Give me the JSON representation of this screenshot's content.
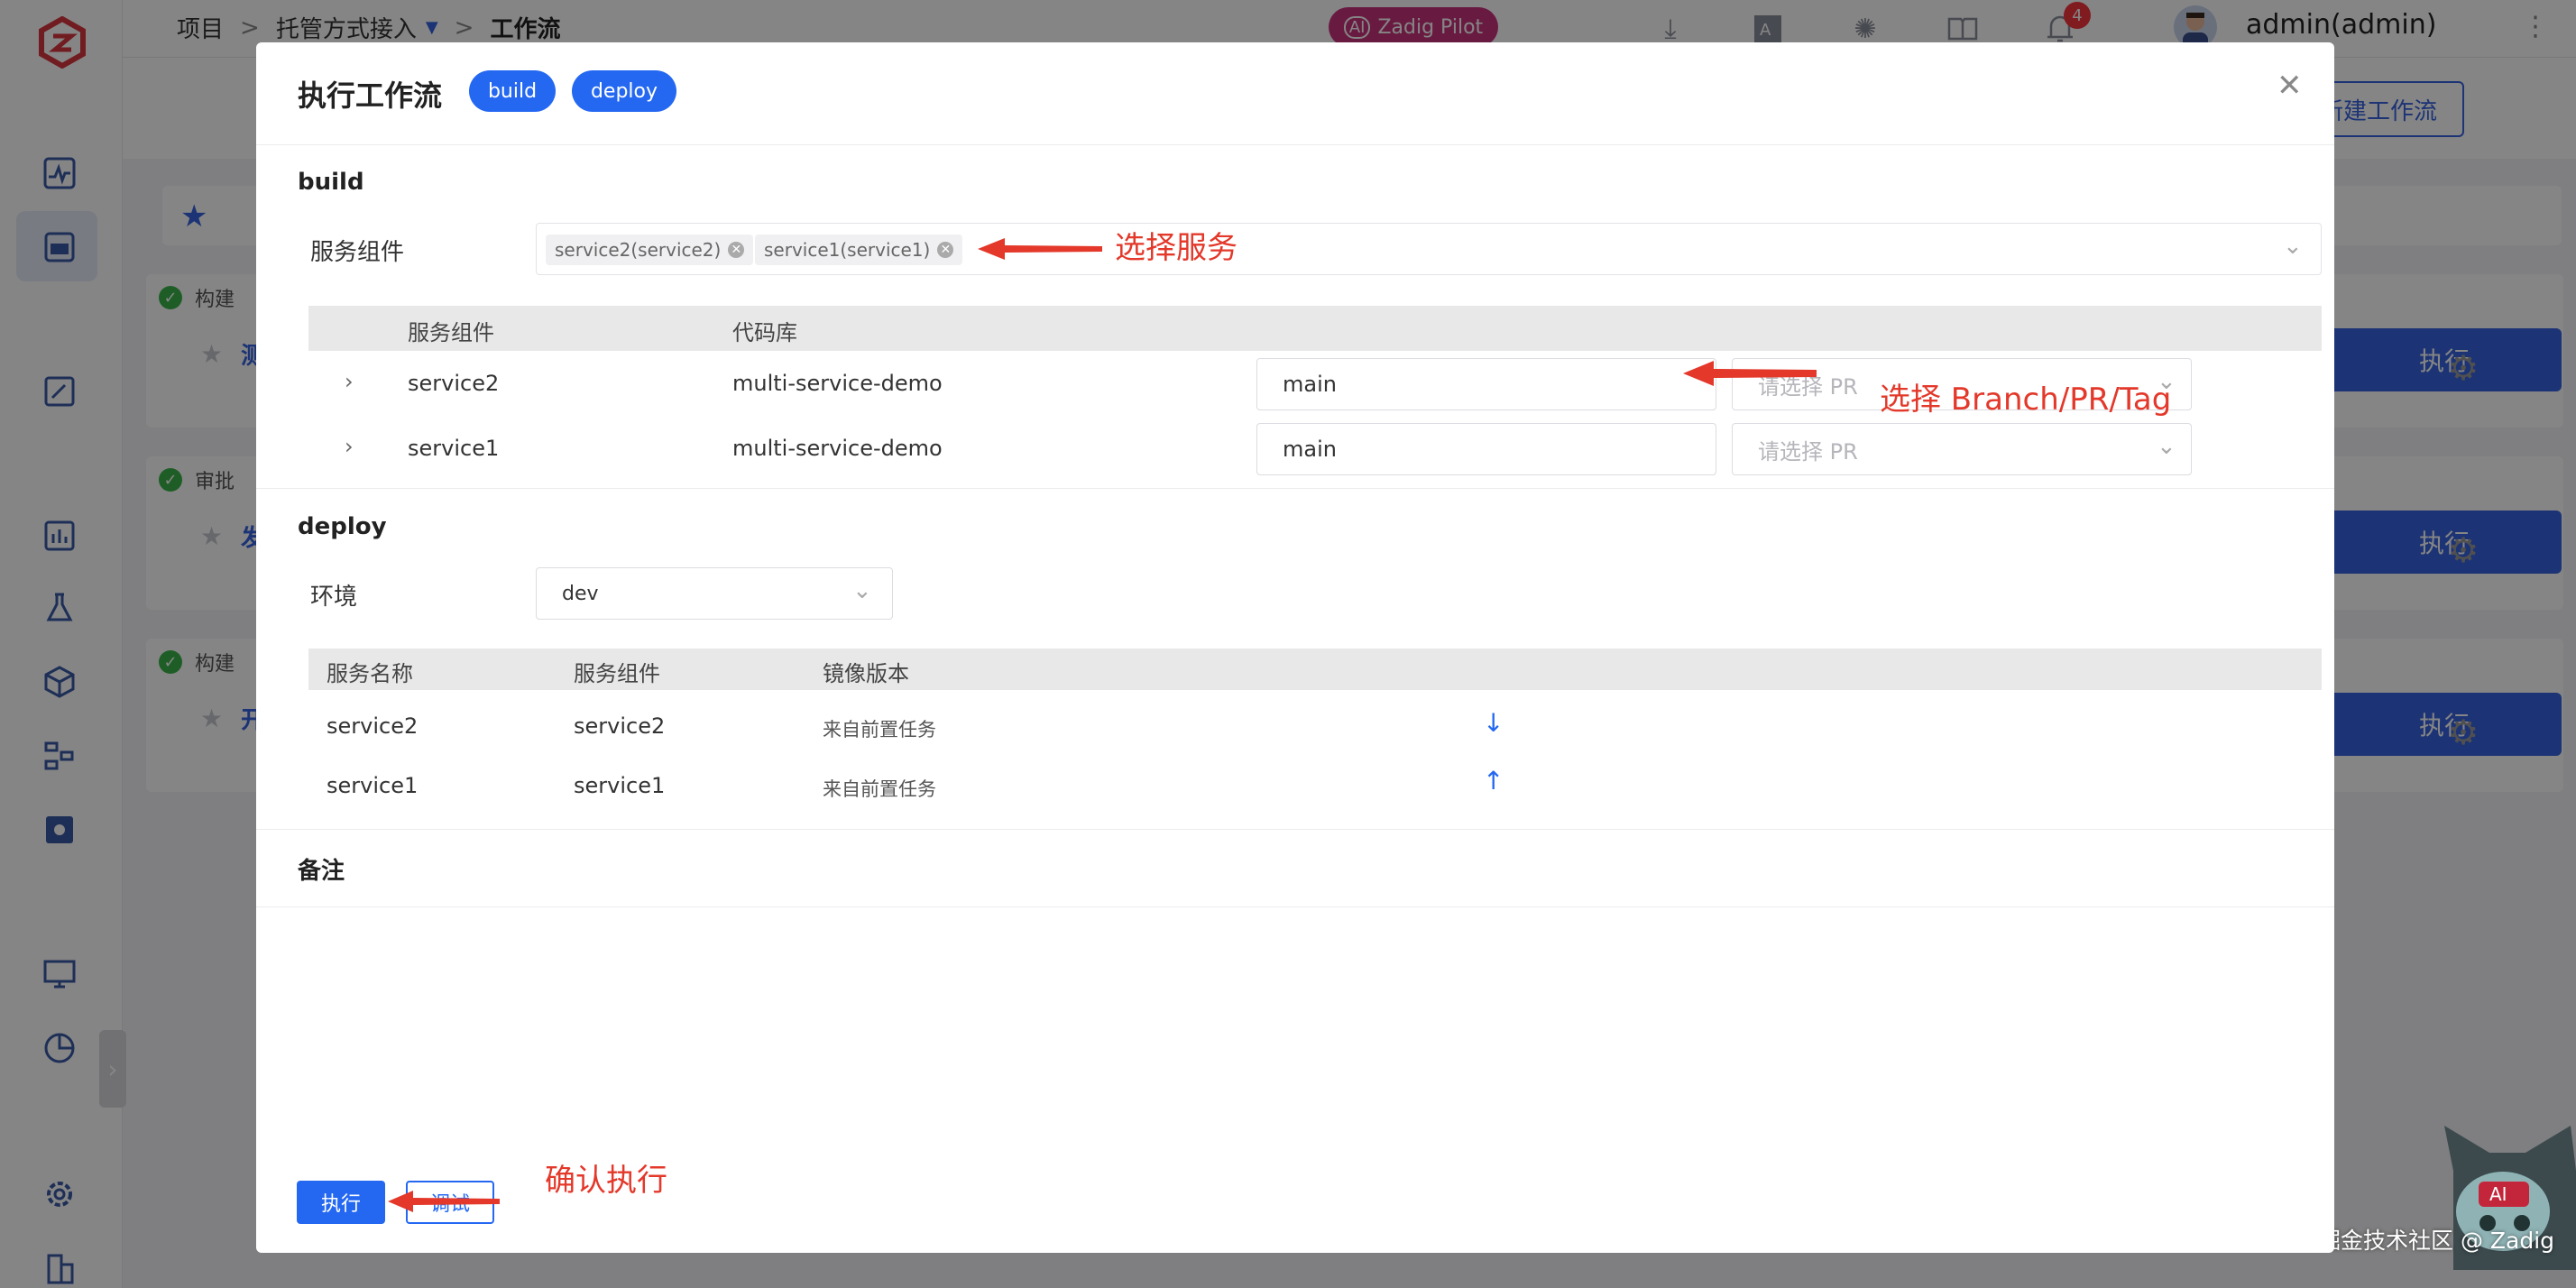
{
  "breadcrumb": {
    "project": "项目",
    "sep": ">",
    "mode": "托管方式接入",
    "current": "工作流"
  },
  "topbar": {
    "pilot": "Zadig Pilot",
    "notifications": "4",
    "username": "admin(admin)"
  },
  "background": {
    "new_workflow": "新建工作流",
    "cards": [
      {
        "tag": "构建",
        "name": "测试工",
        "run": "执行"
      },
      {
        "tag": "审批",
        "name": "发布工",
        "run": "执行"
      },
      {
        "tag": "构建",
        "name": "开发工",
        "run": "执行"
      }
    ]
  },
  "modal": {
    "title": "执行工作流",
    "tabs": [
      "build",
      "deploy"
    ],
    "build": {
      "section": "build",
      "service_label": "服务组件",
      "selected": [
        "service2(service2)",
        "service1(service1)"
      ],
      "table_headers": [
        "服务组件",
        "代码库"
      ],
      "rows": [
        {
          "service": "service2",
          "repo": "multi-service-demo",
          "branch": "main",
          "pr_placeholder": "请选择 PR"
        },
        {
          "service": "service1",
          "repo": "multi-service-demo",
          "branch": "main",
          "pr_placeholder": "请选择 PR"
        }
      ]
    },
    "deploy": {
      "section": "deploy",
      "env_label": "环境",
      "env_value": "dev",
      "table_headers": [
        "服务名称",
        "服务组件",
        "镜像版本"
      ],
      "rows": [
        {
          "name": "service2",
          "component": "service2",
          "image": "来自前置任务"
        },
        {
          "name": "service1",
          "component": "service1",
          "image": "来自前置任务"
        }
      ]
    },
    "notes": {
      "section": "备注"
    },
    "buttons": {
      "run": "执行",
      "debug": "调试"
    }
  },
  "annotations": {
    "select_service": "选择服务",
    "select_branch": "选择 Branch/PR/Tag",
    "confirm": "确认执行"
  },
  "watermark": "掘金技术社区 @ Zadig",
  "colors": {
    "primary": "#2468f2",
    "annotation": "#e3382a",
    "pilot": "#c9327e",
    "success": "#3ab54a"
  }
}
